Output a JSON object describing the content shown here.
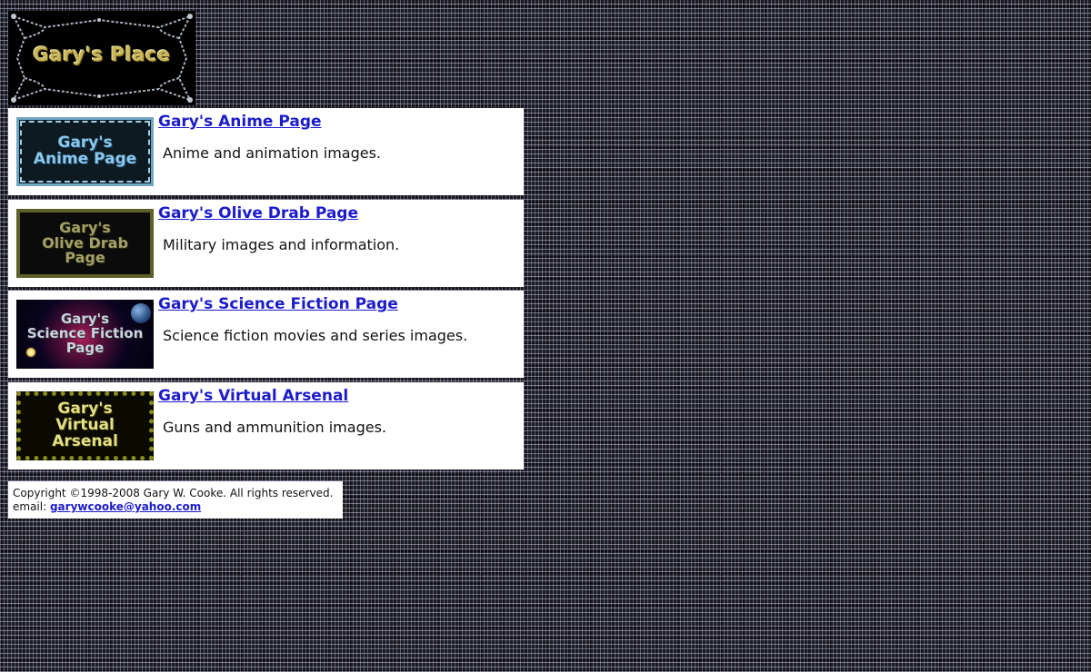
{
  "logo": {
    "text": "Gary's Place",
    "text_color": "#c9b65a"
  },
  "entries": [
    {
      "thumb_text": "Gary's\nAnime Page",
      "link": "Gary's Anime Page",
      "description": "Anime and animation images."
    },
    {
      "thumb_text": "Gary's\nOlive Drab\nPage",
      "link": "Gary's Olive Drab Page",
      "description": "Military images and information."
    },
    {
      "thumb_text": "Gary's\nScience Fiction\nPage",
      "link": "Gary's Science Fiction Page",
      "description": "Science fiction movies and series images."
    },
    {
      "thumb_text": "Gary's\nVirtual\nArsenal",
      "link": "Gary's Virtual Arsenal",
      "description": "Guns and ammunition images."
    }
  ],
  "footer": {
    "copyright": "Copyright ©1998-2008 Gary W. Cooke. All rights reserved.",
    "email_label": "email:",
    "email": "garywcooke@yahoo.com"
  },
  "colors": {
    "link": "#1c1ccc",
    "panel_background": "#ffffff"
  }
}
